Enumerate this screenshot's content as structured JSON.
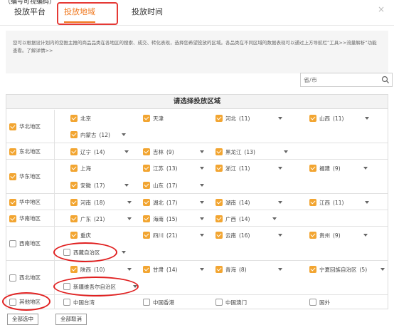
{
  "top_clipped": "（编号可视编码）",
  "tabs": [
    {
      "label": "投放平台"
    },
    {
      "label": "投放地域"
    },
    {
      "label": "投放时间"
    }
  ],
  "close_label": "×",
  "tip": {
    "text": "您可以根据设计划内的您推主推的商品品类在各地区的搜索、成交、转化表现，选择您希望投放的区域。各品类在不同区域的数据表现可以通过上方导航栏”工具>>流量解析”功能查看。",
    "link": "了解详情>>"
  },
  "search": {
    "placeholder": "省/市"
  },
  "table_title": "请选择投放区域",
  "regions": {
    "north": {
      "label": "华北地区",
      "checked": true,
      "provinces": [
        {
          "name": "北京",
          "count": "",
          "checked": true
        },
        {
          "name": "天津",
          "count": "",
          "checked": true
        },
        {
          "name": "河北",
          "count": "(11)",
          "checked": true
        },
        {
          "name": "山西",
          "count": "(11)",
          "checked": true
        },
        {
          "name": "内蒙古",
          "count": "(12)",
          "checked": true
        }
      ]
    },
    "northeast": {
      "label": "东北地区",
      "checked": true,
      "provinces": [
        {
          "name": "辽宁",
          "count": "(14)",
          "checked": true
        },
        {
          "name": "吉林",
          "count": "(9)",
          "checked": true
        },
        {
          "name": "黑龙江",
          "count": "(13)",
          "checked": true
        }
      ]
    },
    "east": {
      "label": "华东地区",
      "checked": true,
      "provinces": [
        {
          "name": "上海",
          "count": "",
          "checked": true
        },
        {
          "name": "江苏",
          "count": "(13)",
          "checked": true
        },
        {
          "name": "浙江",
          "count": "(11)",
          "checked": true
        },
        {
          "name": "福建",
          "count": "(9)",
          "checked": true
        },
        {
          "name": "安徽",
          "count": "(17)",
          "checked": true
        },
        {
          "name": "山东",
          "count": "(17)",
          "checked": true
        }
      ]
    },
    "central": {
      "label": "华中地区",
      "checked": true,
      "provinces": [
        {
          "name": "河南",
          "count": "(18)",
          "checked": true
        },
        {
          "name": "湖北",
          "count": "(17)",
          "checked": true
        },
        {
          "name": "湖南",
          "count": "(14)",
          "checked": true
        },
        {
          "name": "江西",
          "count": "(11)",
          "checked": true
        }
      ]
    },
    "south": {
      "label": "华南地区",
      "checked": true,
      "provinces": [
        {
          "name": "广东",
          "count": "(21)",
          "checked": true
        },
        {
          "name": "海南",
          "count": "(15)",
          "checked": true
        },
        {
          "name": "广西",
          "count": "(14)",
          "checked": true
        }
      ]
    },
    "southwest": {
      "label": "西南地区",
      "checked": false,
      "provinces": [
        {
          "name": "重庆",
          "count": "",
          "checked": true
        },
        {
          "name": "四川",
          "count": "(21)",
          "checked": true
        },
        {
          "name": "云南",
          "count": "(16)",
          "checked": true
        },
        {
          "name": "贵州",
          "count": "(9)",
          "checked": true
        },
        {
          "name": "西藏自治区",
          "count": "",
          "checked": false
        }
      ]
    },
    "northwest": {
      "label": "西北地区",
      "checked": false,
      "provinces": [
        {
          "name": "陕西",
          "count": "(10)",
          "checked": true
        },
        {
          "name": "甘肃",
          "count": "(14)",
          "checked": true
        },
        {
          "name": "青海",
          "count": "(8)",
          "checked": true
        },
        {
          "name": "宁夏回族自治区",
          "count": "(5)",
          "checked": true
        },
        {
          "name": "新疆维吾尔自治区",
          "count": "",
          "checked": false
        }
      ]
    },
    "other": {
      "label": "其他地区",
      "checked": false,
      "provinces": [
        {
          "name": "中国台湾",
          "count": "",
          "checked": false
        },
        {
          "name": "中国香港",
          "count": "",
          "checked": false
        },
        {
          "name": "中国澳门",
          "count": "",
          "checked": false
        },
        {
          "name": "国外",
          "count": "",
          "checked": false
        }
      ]
    }
  },
  "buttons": {
    "select_all": "全部选中",
    "cancel_all": "全部取消"
  },
  "colors": {
    "accent": "#f0781e",
    "checkbox_on": "#f2a531",
    "highlight": "#e53935"
  }
}
